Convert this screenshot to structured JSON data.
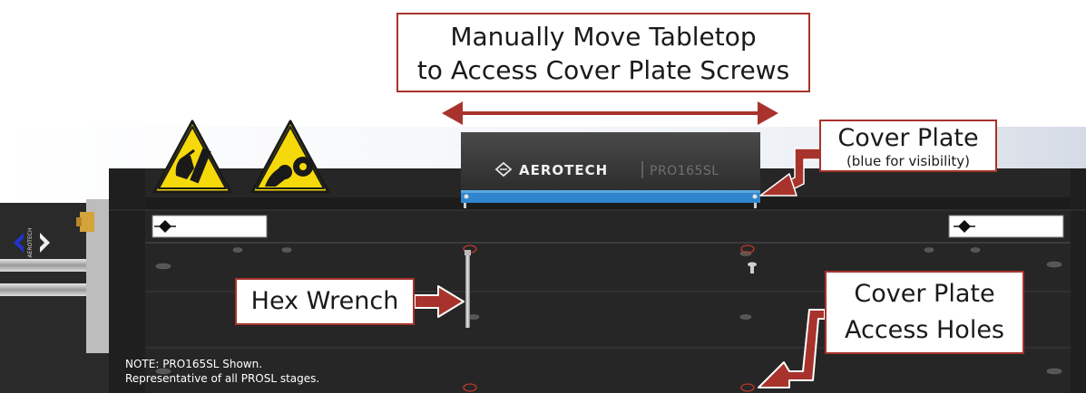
{
  "callouts": {
    "move_tabletop": {
      "line1": "Manually Move Tabletop",
      "line2": "to Access Cover Plate Screws"
    },
    "cover_plate": {
      "title": "Cover Plate",
      "subtitle": "(blue for visibility)"
    },
    "hex_wrench": {
      "label": "Hex Wrench"
    },
    "access_holes": {
      "line1": "Cover Plate",
      "line2": "Access Holes"
    }
  },
  "product": {
    "brand": "AEROTECH",
    "model": "PRO165SL",
    "side_logo": "AEROTECH"
  },
  "warning_signs": [
    "hand-crush-warning-icon",
    "entanglement-warning-icon"
  ],
  "note": {
    "line1": "NOTE: PRO165SL Shown.",
    "line2": "Representative of all PROSL stages."
  },
  "colors": {
    "callout_border": "#a8332c",
    "arrow": "#a8332c",
    "cover_plate": "#2f86cc",
    "warning_yellow": "#f5d90a",
    "stage_body": "#262626"
  }
}
